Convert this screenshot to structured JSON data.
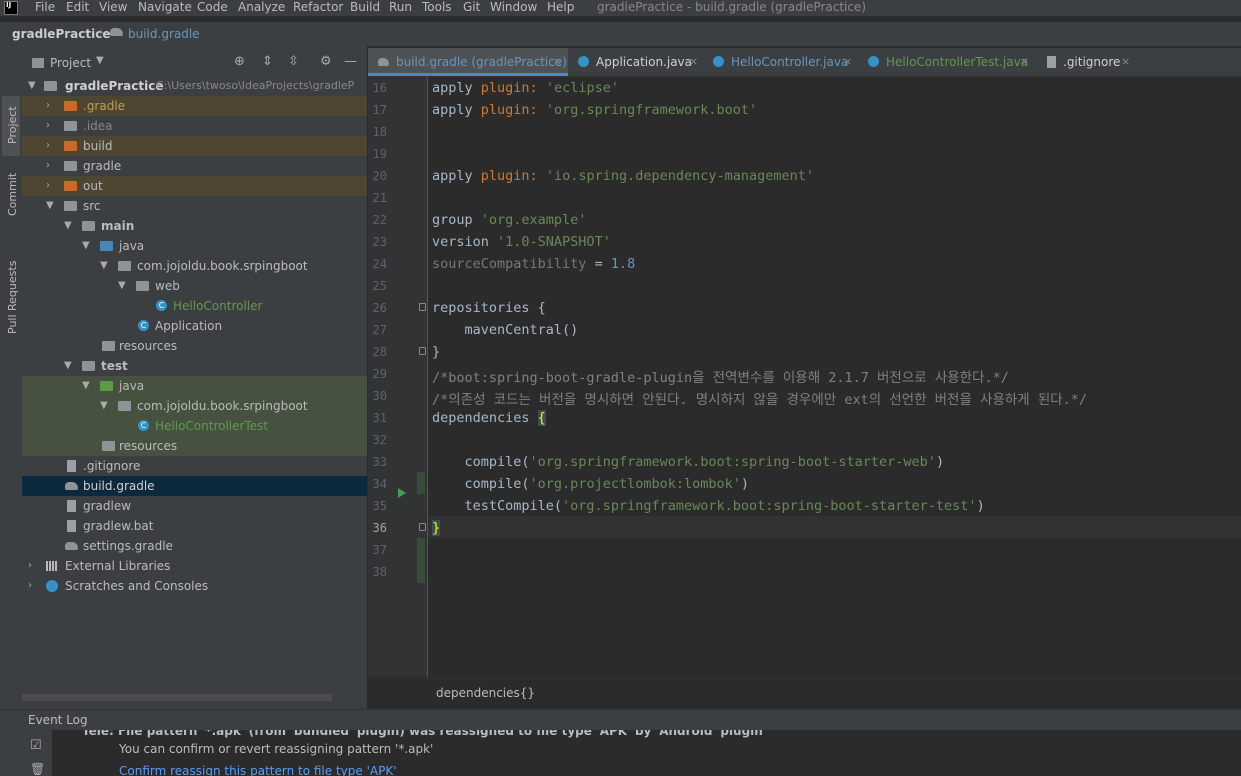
{
  "menubar": {
    "logo": "IJ",
    "items": [
      "File",
      "Edit",
      "View",
      "Navigate",
      "Code",
      "Analyze",
      "Refactor",
      "Build",
      "Run",
      "Tools",
      "Git",
      "Window",
      "Help"
    ],
    "window_title": "gradlePractice - build.gradle (gradlePractice)"
  },
  "navbar": {
    "project": "gradlePractice",
    "file": "build.gradle"
  },
  "toolwindow_tabs": [
    "Project",
    "Commit",
    "Pull Requests"
  ],
  "project_panel": {
    "title": "Project",
    "tree": [
      {
        "label": "gradlePractice",
        "path": "C:\\Users\\twoso\\IdeaProjects\\gradleP"
      },
      {
        "label": ".gradle"
      },
      {
        "label": ".idea"
      },
      {
        "label": "build"
      },
      {
        "label": "gradle"
      },
      {
        "label": "out"
      },
      {
        "label": "src"
      },
      {
        "label": "main"
      },
      {
        "label": "java"
      },
      {
        "label": "com.jojoldu.book.srpingboot"
      },
      {
        "label": "web"
      },
      {
        "label": "HelloController"
      },
      {
        "label": "Application"
      },
      {
        "label": "resources"
      },
      {
        "label": "test"
      },
      {
        "label": "java"
      },
      {
        "label": "com.jojoldu.book.srpingboot"
      },
      {
        "label": "HelloControllerTest"
      },
      {
        "label": "resources"
      },
      {
        "label": ".gitignore"
      },
      {
        "label": "build.gradle"
      },
      {
        "label": "gradlew"
      },
      {
        "label": "gradlew.bat"
      },
      {
        "label": "settings.gradle"
      },
      {
        "label": "External Libraries"
      },
      {
        "label": "Scratches and Consoles"
      }
    ]
  },
  "tabs": [
    {
      "label": "build.gradle (gradlePractice)",
      "close": "×",
      "active": true
    },
    {
      "label": "Application.java",
      "close": "×"
    },
    {
      "label": "HelloController.java",
      "close": "×"
    },
    {
      "label": "HelloControllerTest.java",
      "close": "×"
    },
    {
      "label": ".gitignore",
      "close": "×"
    }
  ],
  "editor": {
    "line_numbers": [
      "16",
      "17",
      "18",
      "19",
      "20",
      "21",
      "22",
      "23",
      "24",
      "25",
      "26",
      "27",
      "28",
      "29",
      "30",
      "31",
      "32",
      "33",
      "34",
      "35",
      "36",
      "37",
      "38"
    ],
    "lines": [
      {
        "n": "16",
        "parts": [
          [
            "",
            "apply "
          ],
          [
            "kw",
            "plugin: "
          ],
          [
            "str",
            "'eclipse'"
          ]
        ]
      },
      {
        "n": "17",
        "parts": [
          [
            "",
            "apply "
          ],
          [
            "kw",
            "plugin: "
          ],
          [
            "str",
            "'org.springframework.boot'"
          ]
        ]
      },
      {
        "n": "18",
        "parts": []
      },
      {
        "n": "19",
        "parts": []
      },
      {
        "n": "20",
        "parts": [
          [
            "",
            "apply "
          ],
          [
            "kw",
            "plugin: "
          ],
          [
            "str",
            "'io.spring.dependency-management'"
          ]
        ]
      },
      {
        "n": "21",
        "parts": []
      },
      {
        "n": "22",
        "parts": [
          [
            "",
            "group "
          ],
          [
            "str",
            "'org.example'"
          ]
        ]
      },
      {
        "n": "23",
        "parts": [
          [
            "",
            "version "
          ],
          [
            "str",
            "'1.0-SNAPSHOT'"
          ]
        ]
      },
      {
        "n": "24",
        "parts": [
          [
            "faded",
            "sourceCompatibility "
          ],
          [
            "",
            "= "
          ],
          [
            "num",
            "1.8"
          ]
        ]
      },
      {
        "n": "25",
        "parts": []
      },
      {
        "n": "26",
        "parts": [
          [
            "",
            "repositories {"
          ]
        ]
      },
      {
        "n": "27",
        "parts": [
          [
            "",
            "    mavenCentral()"
          ]
        ]
      },
      {
        "n": "28",
        "parts": [
          [
            "",
            "}"
          ]
        ]
      },
      {
        "n": "29",
        "parts": [
          [
            "cm",
            "/*boot:spring-boot-gradle-plugin을 전역변수를 이용해 2.1.7 버전으로 사용한다.*/"
          ]
        ]
      },
      {
        "n": "30",
        "parts": [
          [
            "cm",
            "/*의존성 코드는 버전을 명시하면 안된다. 명시하지 않을 경우에만 ext의 선언한 버전을 사용하게 된다.*/"
          ]
        ]
      },
      {
        "n": "31",
        "parts": [
          [
            "",
            "dependencies "
          ],
          [
            "brace-hl",
            "{"
          ]
        ]
      },
      {
        "n": "32",
        "parts": []
      },
      {
        "n": "33",
        "parts": [
          [
            "",
            "    compile("
          ],
          [
            "str",
            "'org.springframework.boot:spring-boot-starter-web'"
          ],
          [
            "",
            ")"
          ]
        ]
      },
      {
        "n": "34",
        "parts": [
          [
            "",
            "    compile("
          ],
          [
            "str",
            "'org.projectlombok:lombok'"
          ],
          [
            "",
            ")"
          ]
        ]
      },
      {
        "n": "35",
        "parts": [
          [
            "",
            "    testCompile("
          ],
          [
            "str",
            "'org.springframework.boot:spring-boot-starter-test'"
          ],
          [
            "",
            ")"
          ]
        ]
      },
      {
        "n": "36",
        "parts": [
          [
            "brace-hl",
            "}"
          ]
        ]
      },
      {
        "n": "37",
        "parts": []
      },
      {
        "n": "38",
        "parts": []
      }
    ],
    "breadcrumb": "dependencies{}"
  },
  "event_log": {
    "title": "Event Log",
    "line1": "Tele: File pattern '*.apk' (from 'bundled' plugin) was reassigned to file type 'APK' by 'Android' plugin",
    "line2": "You can confirm or revert reassigning pattern '*.apk'",
    "link": "Confirm reassign this pattern to file type 'APK'"
  },
  "colors": {
    "accent": "#4a88c7",
    "string": "#6a8759",
    "keyword": "#cc7832",
    "number": "#6897bb",
    "comment": "#808080"
  }
}
